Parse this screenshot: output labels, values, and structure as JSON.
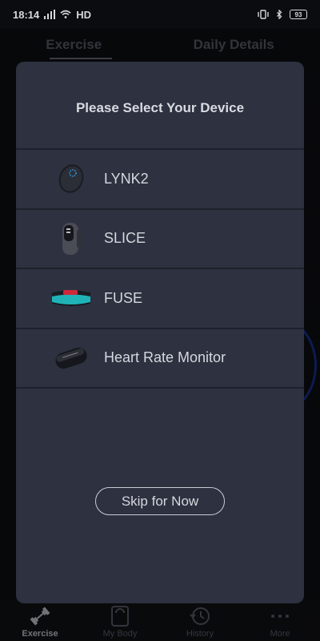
{
  "status_bar": {
    "time": "18:14",
    "network": "HD",
    "battery": "93"
  },
  "background": {
    "tabs": [
      "Exercise",
      "Daily Details"
    ]
  },
  "bottom_nav": {
    "items": [
      {
        "label": "Exercise",
        "icon": "dumbbell-icon",
        "active": true
      },
      {
        "label": "My Body",
        "icon": "scale-icon",
        "active": false
      },
      {
        "label": "History",
        "icon": "history-icon",
        "active": false
      },
      {
        "label": "More",
        "icon": "more-dots-icon",
        "active": false
      }
    ]
  },
  "modal": {
    "title": "Please Select Your Device",
    "devices": [
      {
        "label": "LYNK2",
        "icon": "lynk2-device-icon"
      },
      {
        "label": "SLICE",
        "icon": "slice-band-icon"
      },
      {
        "label": "FUSE",
        "icon": "fuse-armband-icon"
      },
      {
        "label": "Heart Rate Monitor",
        "icon": "heart-rate-strap-icon"
      }
    ],
    "skip_label": "Skip for Now"
  },
  "colors": {
    "modal_bg": "#2d3140",
    "divider": "#1e212b",
    "text": "#d6d8de",
    "accent_teal": "#1fb3b8",
    "accent_red": "#d0273a"
  }
}
